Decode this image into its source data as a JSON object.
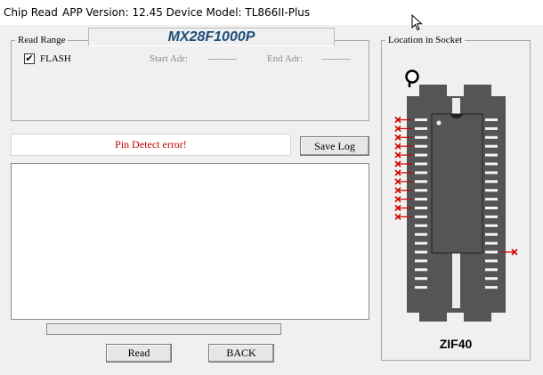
{
  "window": {
    "title": "Chip Read",
    "info": "APP Version: 12.45 Device Model: TL866II-Plus"
  },
  "chip": {
    "model": "MX28F1000P"
  },
  "read_range": {
    "legend": "Read Range",
    "flash_label": "FLASH",
    "flash_checked": true,
    "start_label": "Start Adr:",
    "start_value": "---------",
    "end_label": "End Adr:",
    "end_value": "---------"
  },
  "status": {
    "message": "Pin Detect error!",
    "color": "#c00000"
  },
  "buttons": {
    "save_log": "Save Log",
    "read": "Read",
    "back": "BACK"
  },
  "progress": {
    "percent": 0
  },
  "socket": {
    "legend": "Location in Socket",
    "name": "ZIF40",
    "pins_per_side": 20,
    "chip_pins_per_side": 16,
    "error_pins_left": [
      1,
      2,
      3,
      4,
      5,
      6,
      7,
      8,
      9,
      10,
      11,
      12
    ],
    "error_pins_right": [
      16
    ],
    "error_color": "#cc0000"
  },
  "log": {
    "lines": []
  }
}
